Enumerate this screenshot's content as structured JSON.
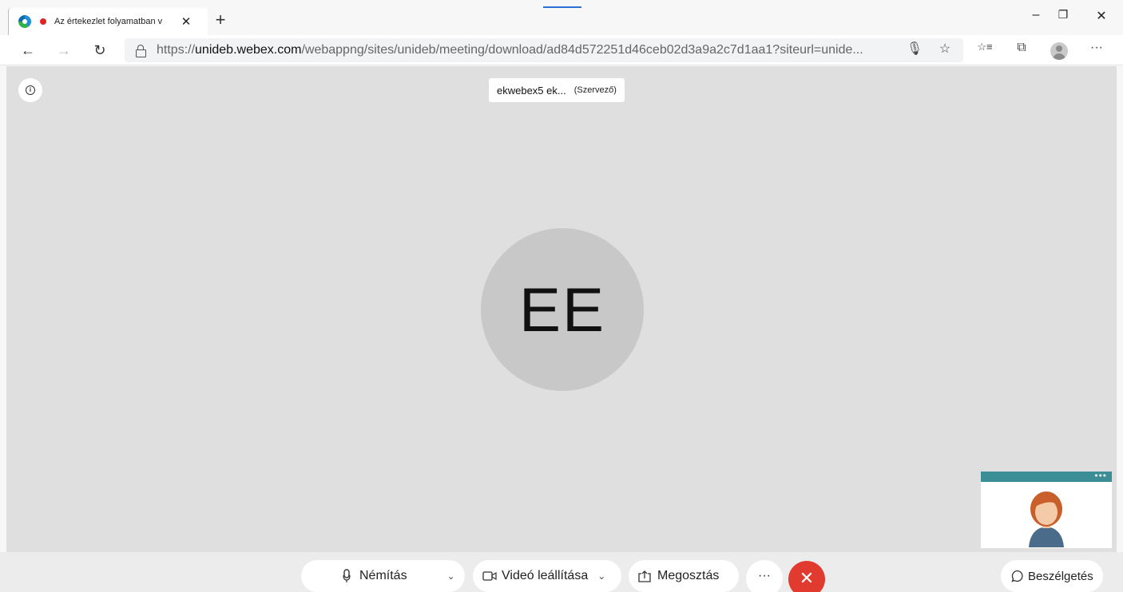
{
  "browser": {
    "tab_title": "Az értekezlet folyamatban v",
    "tab_close": "✕",
    "new_tab": "+",
    "window_controls": {
      "minimize": "–",
      "restore": "❐",
      "close": "✕"
    },
    "url_prefix": "https://",
    "url_host": "unideb.webex.com",
    "url_path": "/webappng/sites/unideb/meeting/download/ad84d572251d46ceb02d3a9a2c7d1aa1?siteurl=unide...",
    "icons": {
      "back": "←",
      "forward": "→",
      "refresh": "↻",
      "mic": "🎙",
      "star": "☆",
      "favorites": "☆≡",
      "collections": "⧉",
      "more": "···"
    }
  },
  "meeting": {
    "info_glyph": "i",
    "participant_name": "ekwebex5 ek...",
    "participant_role": "(Szervező)",
    "avatar_initials": "EE",
    "selfview_menu": "•••"
  },
  "controls": {
    "mute_label": "Némítás",
    "mute_chevron": "⌄",
    "video_label": "Videó leállítása",
    "video_chevron": "⌄",
    "share_label": "Megosztás",
    "more_label": "···",
    "leave_label": "✕",
    "chat_label": "Beszélgetés"
  }
}
